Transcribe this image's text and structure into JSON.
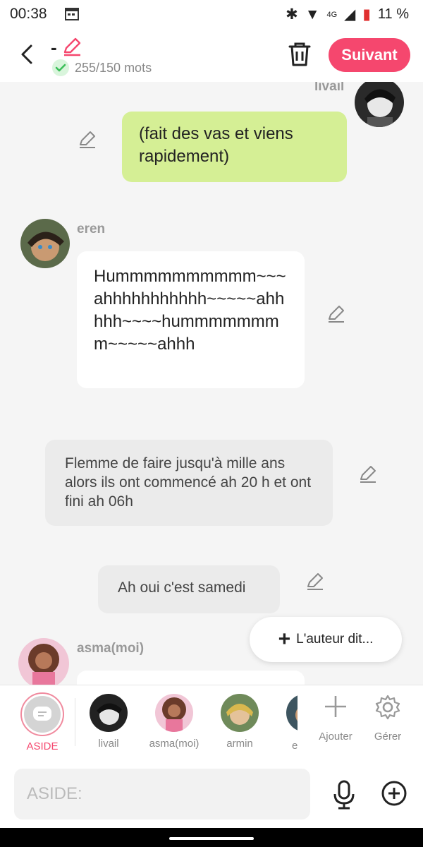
{
  "status_bar": {
    "time": "00:38",
    "network": "4G",
    "battery": "11 %"
  },
  "header": {
    "title": "-",
    "word_count": "255/150 mots",
    "next_label": "Suivant",
    "accent_color": "#f5476e"
  },
  "messages": [
    {
      "author": "livail",
      "text": "(fait des vas et viens rapidement)",
      "style": "green"
    },
    {
      "author": "eren",
      "text": "Hummmmmmmmmm~~~ahhhhhhhhhhh~~~~~ahhhhh~~~~hummmmmmmm~~~~~ahhh",
      "style": "white"
    },
    {
      "author": "",
      "text": "Flemme de faire jusqu'à mille ans alors ils ont commencé ah 20 h et ont fini ah 06h",
      "style": "grey"
    },
    {
      "author": "",
      "text": "Ah oui c'est samedi",
      "style": "grey"
    },
    {
      "author": "asma(moi)",
      "text": "",
      "style": "white"
    }
  ],
  "floating": {
    "author_says": "L'auteur dit..."
  },
  "characters": [
    {
      "label": "ASIDE",
      "selected": true
    },
    {
      "label": "livail"
    },
    {
      "label": "asma(moi)"
    },
    {
      "label": "armin"
    },
    {
      "label": "e"
    }
  ],
  "tools": {
    "add_label": "Ajouter",
    "manage_label": "Gérer"
  },
  "composer": {
    "placeholder": "ASIDE:"
  }
}
